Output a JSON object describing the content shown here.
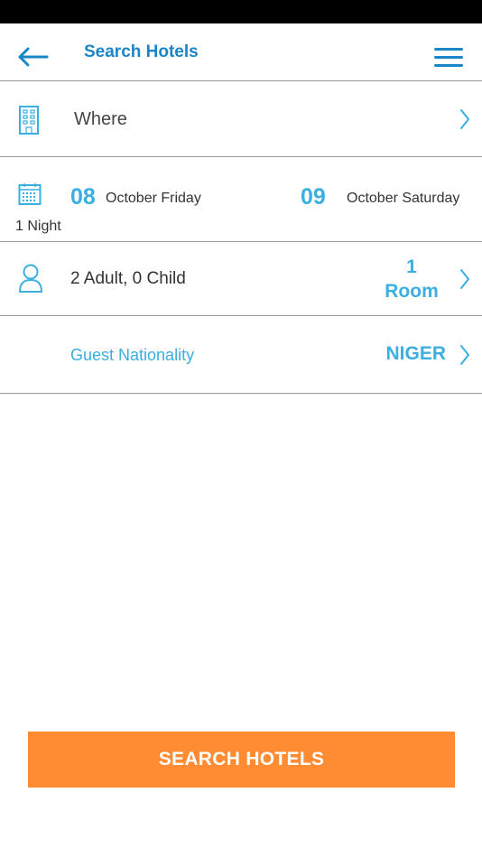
{
  "header": {
    "title": "Search Hotels",
    "back_icon": "arrow-left-icon",
    "menu_icon": "hamburger-menu-icon"
  },
  "where": {
    "label": "Where",
    "icon": "building-icon"
  },
  "dates": {
    "icon": "calendar-icon",
    "check_in_day": "08",
    "check_in_text": "October Friday",
    "check_out_day": "09",
    "check_out_text": "October Saturday",
    "nights": "1 Night"
  },
  "guests": {
    "icon": "person-icon",
    "label": "2 Adult, 0 Child",
    "rooms_count": "1",
    "rooms_label": "Room"
  },
  "nationality": {
    "label": "Guest Nationality",
    "value": "NIGER"
  },
  "search_button": {
    "label": "SEARCH HOTELS"
  },
  "colors": {
    "accent_blue": "#3aafe0",
    "title_blue": "#1a86c8",
    "button_orange": "#ff8c33",
    "divider": "#9a9a9a",
    "status_bar": "#000000"
  }
}
